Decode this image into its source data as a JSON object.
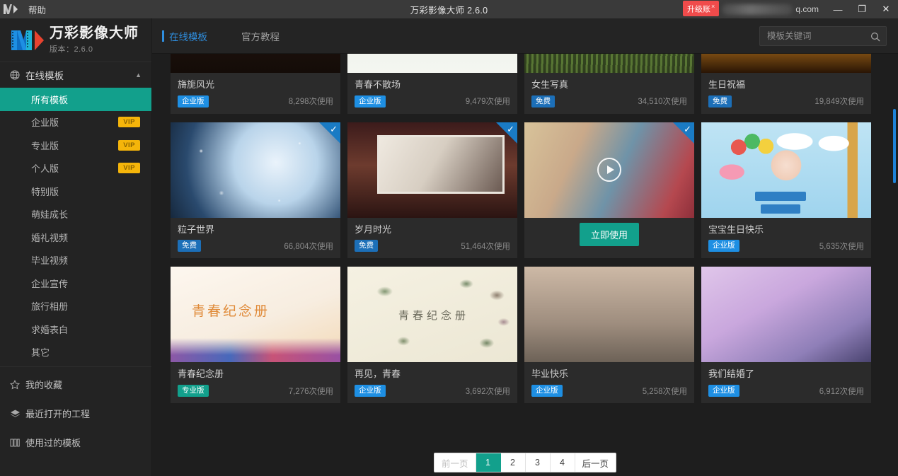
{
  "titlebar": {
    "menu_help": "帮助",
    "title": "万彩影像大师 2.6.0",
    "upgrade_label": "升级账",
    "upgrade_close": "×",
    "account_suffix": "q.com",
    "minimize": "—",
    "restore": "❐",
    "close": "✕"
  },
  "sidebar": {
    "brand_name": "万彩影像大师",
    "brand_version": "版本：2.6.0",
    "group": {
      "label": "在线模板",
      "caret": "▲"
    },
    "items": [
      {
        "label": "所有模板",
        "vip": "",
        "active": true
      },
      {
        "label": "企业版",
        "vip": "VIP",
        "active": false
      },
      {
        "label": "专业版",
        "vip": "VIP",
        "active": false
      },
      {
        "label": "个人版",
        "vip": "VIP",
        "active": false
      },
      {
        "label": "特别版",
        "vip": "",
        "active": false
      },
      {
        "label": "萌娃成长",
        "vip": "",
        "active": false
      },
      {
        "label": "婚礼视频",
        "vip": "",
        "active": false
      },
      {
        "label": "毕业视频",
        "vip": "",
        "active": false
      },
      {
        "label": "企业宣传",
        "vip": "",
        "active": false
      },
      {
        "label": "旅行相册",
        "vip": "",
        "active": false
      },
      {
        "label": "求婚表白",
        "vip": "",
        "active": false
      },
      {
        "label": "其它",
        "vip": "",
        "active": false
      }
    ],
    "footer_items": [
      {
        "label": "我的收藏",
        "icon": "star-icon"
      },
      {
        "label": "最近打开的工程",
        "icon": "layers-icon"
      },
      {
        "label": "使用过的模板",
        "icon": "template-icon"
      }
    ]
  },
  "topbar": {
    "tabs": [
      {
        "label": "在线模板",
        "active": true
      },
      {
        "label": "官方教程",
        "active": false
      }
    ],
    "search_placeholder": "模板关键词",
    "search_value": "",
    "search_icon": "search-icon"
  },
  "grid": {
    "uses_suffix": "次使用",
    "use_button": "立即使用",
    "cards": [
      {
        "title": "旖旎风光",
        "badge": "企业版",
        "badge_type": "ent",
        "uses": "8,298次使用",
        "checked": false,
        "hovered": false,
        "row": 1
      },
      {
        "title": "青春不散场",
        "badge": "企业版",
        "badge_type": "ent",
        "uses": "9,479次使用",
        "checked": false,
        "hovered": false,
        "row": 1
      },
      {
        "title": "女生写真",
        "badge": "免费",
        "badge_type": "free",
        "uses": "34,510次使用",
        "checked": false,
        "hovered": false,
        "row": 1
      },
      {
        "title": "生日祝福",
        "badge": "免费",
        "badge_type": "free",
        "uses": "19,849次使用",
        "checked": false,
        "hovered": false,
        "row": 1
      },
      {
        "title": "粒子世界",
        "badge": "免费",
        "badge_type": "free",
        "uses": "66,804次使用",
        "checked": true,
        "hovered": false,
        "row": 2
      },
      {
        "title": "岁月时光",
        "badge": "免费",
        "badge_type": "free",
        "uses": "51,464次使用",
        "checked": true,
        "hovered": false,
        "row": 2
      },
      {
        "title": "",
        "badge": "",
        "badge_type": "",
        "uses": "",
        "checked": true,
        "hovered": true,
        "row": 2
      },
      {
        "title": "宝宝生日快乐",
        "badge": "企业版",
        "badge_type": "ent",
        "uses": "5,635次使用",
        "checked": false,
        "hovered": false,
        "row": 2
      },
      {
        "title": "青春纪念册",
        "badge": "专业版",
        "badge_type": "pro",
        "uses": "7,276次使用",
        "checked": false,
        "hovered": false,
        "row": 3
      },
      {
        "title": "再见，青春",
        "badge": "企业版",
        "badge_type": "ent",
        "uses": "3,692次使用",
        "checked": false,
        "hovered": false,
        "row": 3
      },
      {
        "title": "毕业快乐",
        "badge": "企业版",
        "badge_type": "ent",
        "uses": "5,258次使用",
        "checked": false,
        "hovered": false,
        "row": 3
      },
      {
        "title": "我们结婚了",
        "badge": "企业版",
        "badge_type": "ent",
        "uses": "6,912次使用",
        "checked": false,
        "hovered": false,
        "row": 3
      }
    ],
    "thumb_texts": {
      "card9_overlay": "青春纪念册",
      "card10_overlay": "青春纪念册"
    }
  },
  "pagination": {
    "prev": "前一页",
    "pages": [
      "1",
      "2",
      "3",
      "4"
    ],
    "active_page": "1",
    "next": "后一页"
  },
  "colors": {
    "accent_teal": "#12a08c",
    "accent_blue": "#2f8fe0",
    "badge_ent": "#1e8fe3",
    "badge_free": "#1c6fb8",
    "vip_gold": "#f5b50a",
    "upgrade_red": "#f04b4b"
  }
}
